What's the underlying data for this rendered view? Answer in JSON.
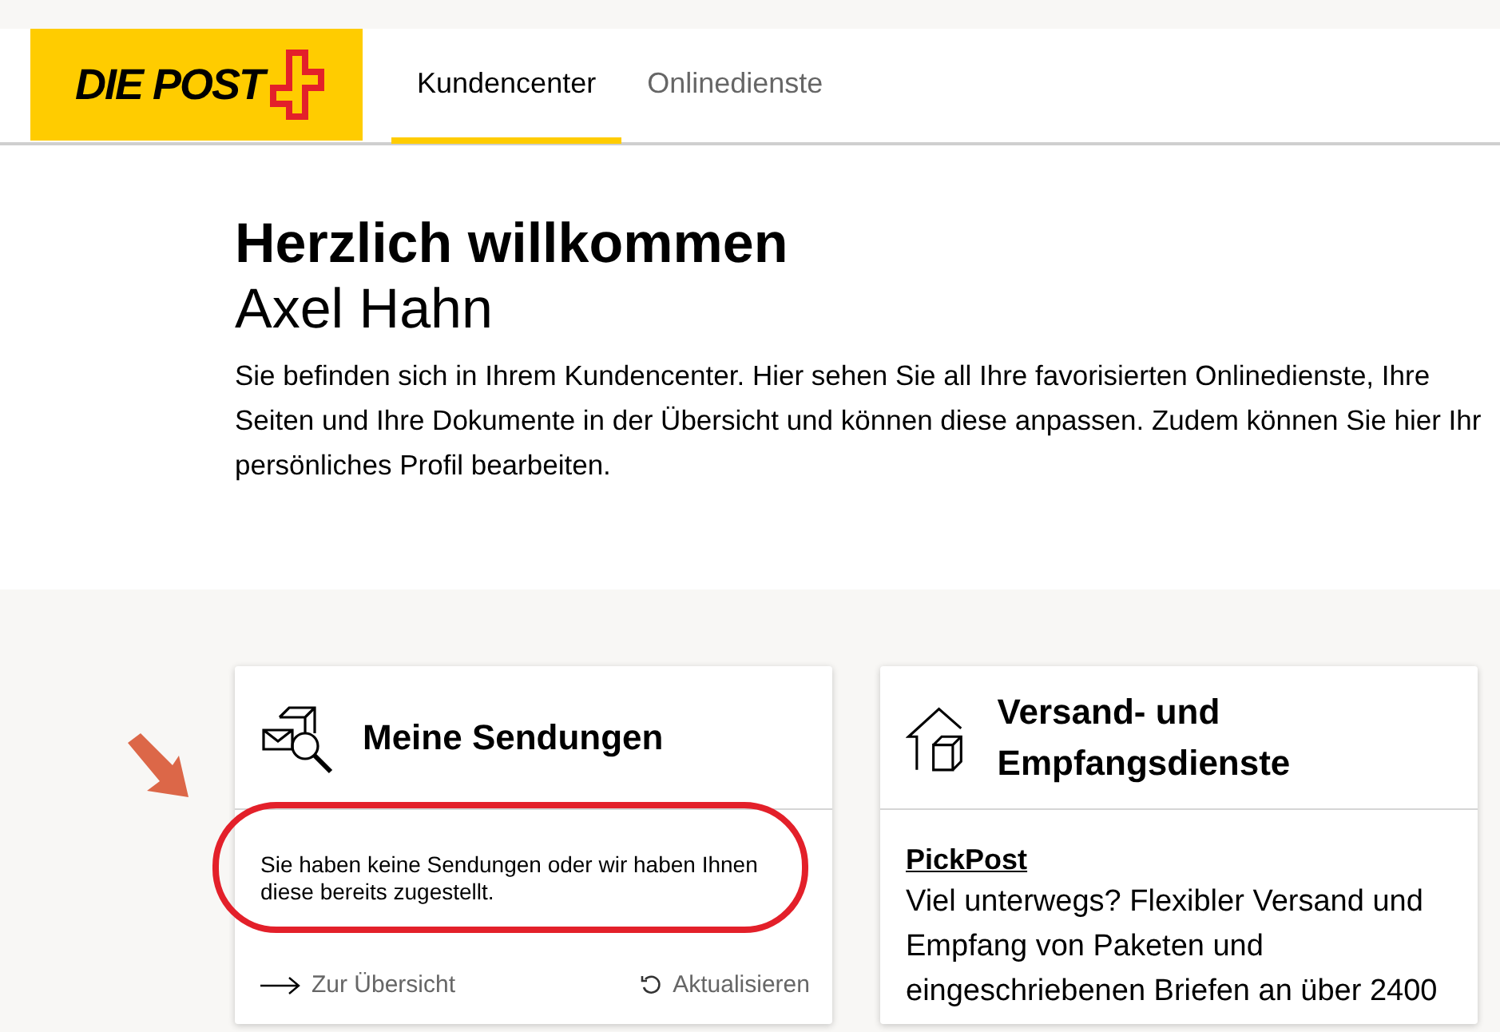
{
  "logo": {
    "text": "DIE POST"
  },
  "tabs": [
    {
      "label": "Kundencenter",
      "selected": true
    },
    {
      "label": "Onlinedienste",
      "selected": false
    }
  ],
  "welcome": {
    "title": "Herzlich willkommen",
    "name": "Axel Hahn",
    "intro": "Sie befinden sich in Ihrem Kundencenter. Hier sehen Sie all Ihre favorisierten Onlinedienste, Ihre Seiten und Ihre Dokumente in der Übersicht und können diese anpassen. Zudem können Sie hier Ihr persönliches Profil bearbeiten."
  },
  "cards": [
    {
      "kind": "shipments",
      "title": "Meine Sendungen",
      "message": "Sie haben keine Sendungen oder wir haben Ihnen diese bereits zugestellt.",
      "links": [
        {
          "kind": "overview",
          "label": "Zur Übersicht"
        },
        {
          "kind": "refresh",
          "label": "Aktualisieren"
        }
      ]
    },
    {
      "kind": "services",
      "title": "Versand- und Empfangsdienste",
      "service": {
        "name": "PickPost",
        "description": "Viel unterwegs? Flexibler Versand und Empfang von Paketen und eingeschriebenen Briefen an über 2400"
      }
    }
  ]
}
